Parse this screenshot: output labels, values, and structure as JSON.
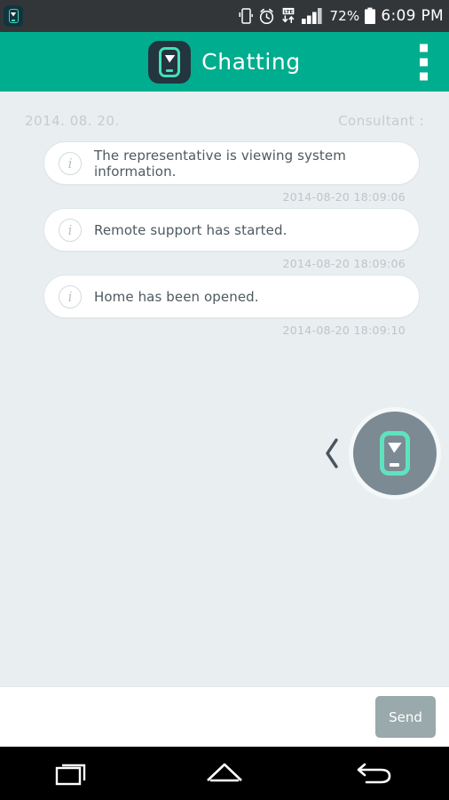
{
  "statusbar": {
    "notification_icon": "app-notification-icon",
    "vibrate_icon": "vibrate-icon",
    "alarm_icon": "alarm-clock-icon",
    "lte_icon": "lte-data-icon",
    "lte_label": "LTE",
    "signal_icon": "signal-bars-icon",
    "battery_percent": "72%",
    "battery_icon": "battery-icon",
    "time": "6:09 PM"
  },
  "header": {
    "app_icon": "chatting-app-icon",
    "title": "Chatting",
    "overflow_icon": "overflow-menu-icon",
    "background_color": "#00ad8e"
  },
  "chat": {
    "date_label": "2014. 08. 20.",
    "consultant_label": "Consultant :",
    "background_color": "#e9eff0",
    "messages": [
      {
        "icon": "info-icon",
        "icon_glyph": "i",
        "text": "The representative is viewing system information.",
        "timestamp": "2014-08-20 18:09:06"
      },
      {
        "icon": "info-icon",
        "icon_glyph": "i",
        "text": "Remote support has started.",
        "timestamp": "2014-08-20 18:09:06"
      },
      {
        "icon": "info-icon",
        "icon_glyph": "i",
        "text": "Home has been opened.",
        "timestamp": "2014-08-20 18:09:10"
      }
    ]
  },
  "floating": {
    "chevron_icon": "chevron-left-icon",
    "fab_icon": "remote-device-icon",
    "fab_color": "#7c8a94"
  },
  "input": {
    "value": "",
    "placeholder": "",
    "send_label": "Send",
    "send_color": "#9aa9ab"
  },
  "navbar": {
    "recents_icon": "recents-icon",
    "home_icon": "home-icon",
    "back_icon": "back-icon"
  }
}
